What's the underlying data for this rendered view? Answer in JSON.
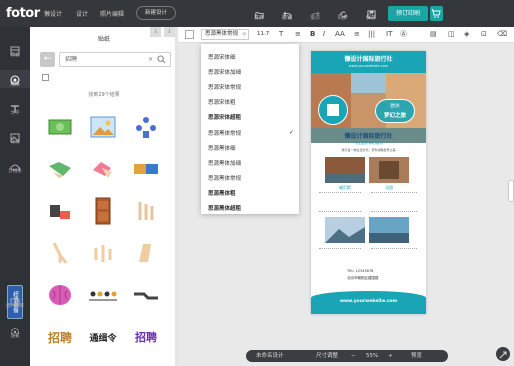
{
  "topbar": {
    "logo": "fotor",
    "logo_sub": "懒设计",
    "nav_design": "设计",
    "nav_photo": "照片编辑",
    "new_design": "新建设计",
    "tools": [
      {
        "label": "打开",
        "icon": "open-icon"
      },
      {
        "label": "撤销",
        "icon": "undo-icon"
      },
      {
        "label": "重做",
        "icon": "redo-icon"
      },
      {
        "label": "同步",
        "icon": "sync-icon"
      },
      {
        "label": "保存",
        "icon": "save-icon"
      }
    ],
    "print_label": "预订印刷",
    "cart_icon": "cart-icon"
  },
  "rail": {
    "items": [
      {
        "label": "模板",
        "icon": "template-icon"
      },
      {
        "label": "贴纸",
        "icon": "sticker-icon"
      },
      {
        "label": "文字",
        "icon": "text-icon"
      },
      {
        "label": "背景",
        "icon": "background-icon"
      },
      {
        "label": "云相册",
        "icon": "cloud-album-icon"
      }
    ],
    "promo": "超值套餐",
    "user_upload": "用户图库",
    "settings": "设置"
  },
  "panel": {
    "title": "贴纸",
    "search_value": "招聘",
    "result_text": "找到29个结果",
    "stickers": [
      "money-bill",
      "landscape-photo",
      "team-people",
      "handshake-green",
      "handshake-pink",
      "puzzle-handshake",
      "puzzle-hands",
      "handshake-fist",
      "door-brown",
      "hand-gesture",
      "hand-point",
      "handshake-beige",
      "finger-point",
      "hands-raised",
      "hand-wave",
      "brain-pink",
      "team-line",
      "handshake-gray",
      "zhaopin-gold",
      "tongjiling-text",
      "zhaopin-purple"
    ],
    "sticker_texts": {
      "zhaopin_gold": "招聘",
      "tongjiling": "通缉令",
      "zhaopin_purple": "招聘"
    }
  },
  "toolbar": {
    "font": "思源黑体常规",
    "font_size": "11.7",
    "tools": [
      "T",
      "≡",
      "B",
      "I",
      "AA",
      "≡",
      "|||",
      "IT"
    ]
  },
  "dropdown": {
    "options": [
      "思源宋体细",
      "思源宋体加细",
      "思源宋体常规",
      "思源宋体粗",
      "思源宋体超粗",
      "思源黑体常规",
      "思源黑体细",
      "思源黑体加细",
      "思源黑体常规",
      "思源黑体粗",
      "思源黑体超粗"
    ],
    "checked_index": 5
  },
  "poster": {
    "title": "懒设计国际旅行社",
    "url_top": "www.yourwebsite.com",
    "badge_line1": "欧洲",
    "badge_line2": "梦幻之旅",
    "subtitle": "懒设计国际旅行社",
    "tagline": "专业品质 精心服务",
    "intro": "旅行是一种生活方式，带你领略世界之美",
    "city1": "威尼斯",
    "city2": "法国",
    "phone": "TEL: 12345678",
    "address": "北京市朝阳区建国路",
    "bottom_url": "www.yourwebsite.com",
    "colors": {
      "teal": "#1aa5b6",
      "navy": "#1d4e7a"
    }
  },
  "zoom": {
    "page_label": "未命名设计",
    "size_label": "尺寸调整",
    "zoom_value": "55%",
    "preview": "预览"
  }
}
